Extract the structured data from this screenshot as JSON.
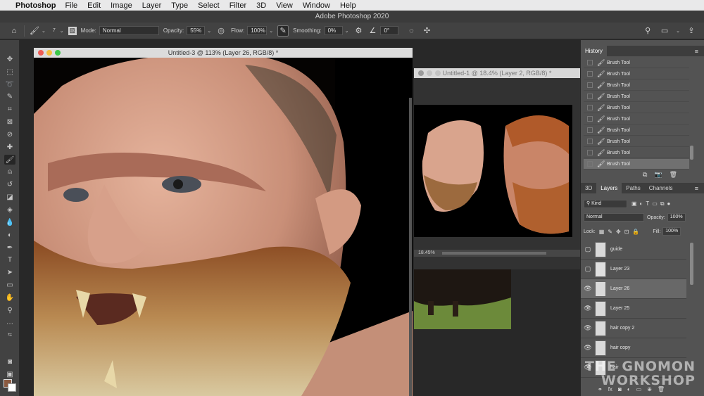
{
  "menubar": {
    "app_name": "Photoshop",
    "items": [
      "File",
      "Edit",
      "Image",
      "Layer",
      "Type",
      "Select",
      "Filter",
      "3D",
      "View",
      "Window",
      "Help"
    ]
  },
  "title": "Adobe Photoshop 2020",
  "options": {
    "brush_size": "7",
    "mode_label": "Mode:",
    "mode_value": "Normal",
    "opacity_label": "Opacity:",
    "opacity_value": "55%",
    "flow_label": "Flow:",
    "flow_value": "100%",
    "smoothing_label": "Smoothing:",
    "smoothing_value": "0%",
    "angle_value": "0°"
  },
  "doc_main": {
    "title": "Untitled-3 @ 113% (Layer 26, RGB/8) *"
  },
  "doc_ref": {
    "title": "Untitled-1 @ 18.4% (Layer 2, RGB/8) *",
    "zoom": "18.45%"
  },
  "history": {
    "tab": "History",
    "items": [
      "Brush Tool",
      "Brush Tool",
      "Brush Tool",
      "Brush Tool",
      "Brush Tool",
      "Brush Tool",
      "Brush Tool",
      "Brush Tool",
      "Brush Tool",
      "Brush Tool"
    ]
  },
  "layers_panel": {
    "tabs": [
      "3D",
      "Layers",
      "Paths",
      "Channels"
    ],
    "filter_kind": "Kind",
    "blend_mode": "Normal",
    "opacity_label": "Opacity:",
    "opacity_value": "100%",
    "lock_label": "Lock:",
    "fill_label": "Fill:",
    "fill_value": "100%",
    "layers": [
      {
        "name": "guide",
        "visible": false,
        "selected": false
      },
      {
        "name": "Layer 23",
        "visible": false,
        "selected": false
      },
      {
        "name": "Layer 26",
        "visible": true,
        "selected": true
      },
      {
        "name": "Layer 25",
        "visible": true,
        "selected": false
      },
      {
        "name": "hair copy 2",
        "visible": true,
        "selected": false
      },
      {
        "name": "hair copy",
        "visible": true,
        "selected": false
      },
      {
        "name": "hair",
        "visible": true,
        "selected": false
      }
    ]
  },
  "watermark": {
    "line1": "THE GNOMON",
    "line2": "WORKSHOP"
  },
  "colors": {
    "foreground": "#8a5a41",
    "background": "#ffffff"
  }
}
